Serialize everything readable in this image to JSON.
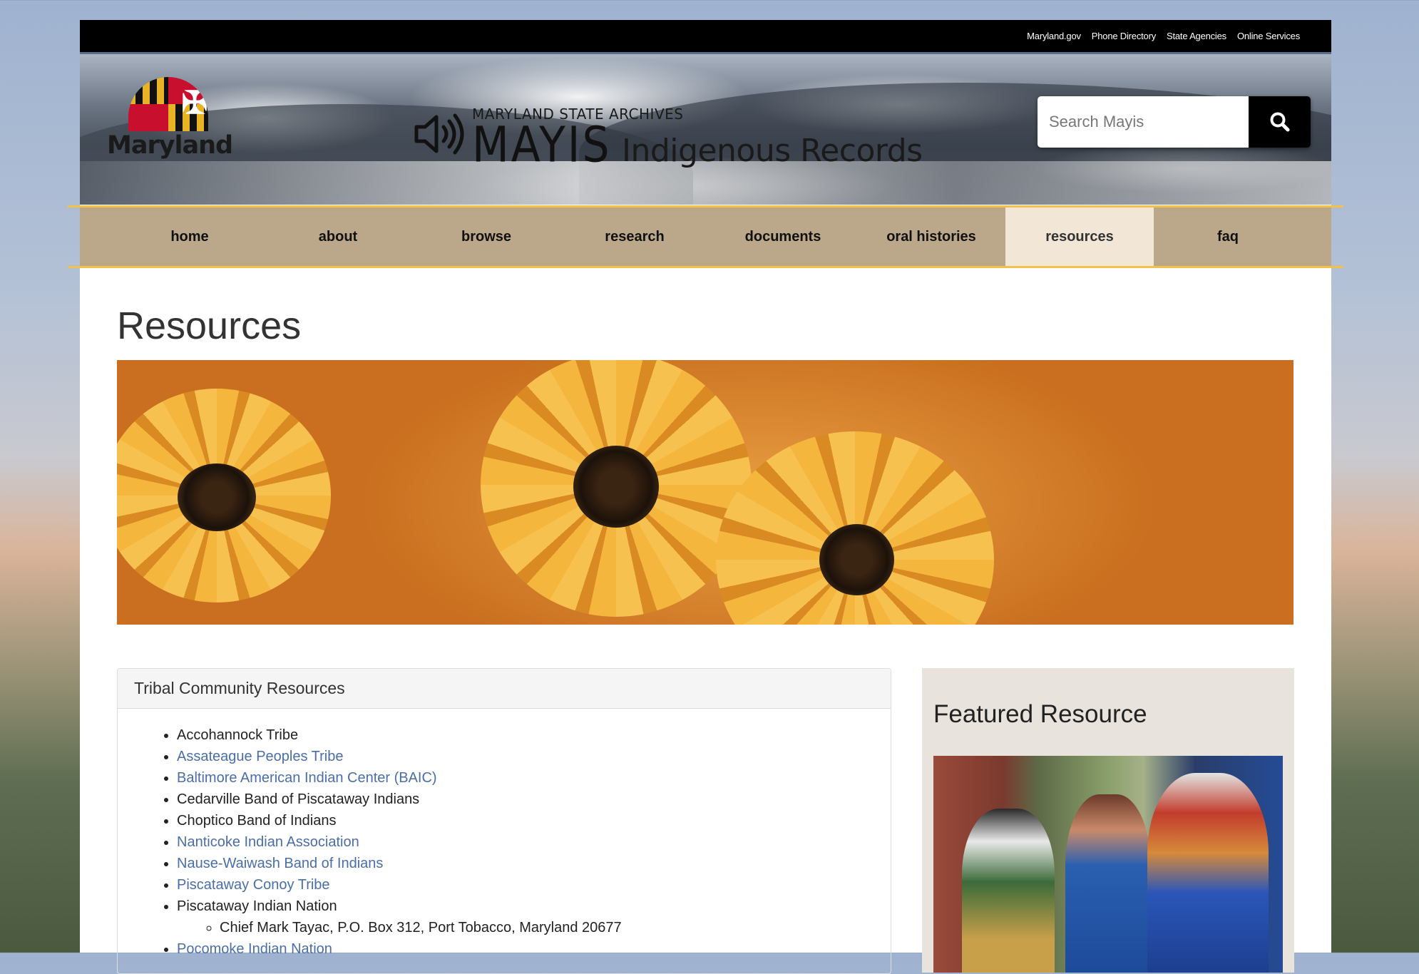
{
  "utility_links": [
    "Maryland.gov",
    "Phone Directory",
    "State Agencies",
    "Online Services"
  ],
  "header": {
    "maryland_logo_text": "Maryland",
    "archive_name": "MARYLAND STATE ARCHIVES",
    "brand": "MAYIS",
    "section_title": "Indigenous Records",
    "search_placeholder": "Search Mayis"
  },
  "nav": {
    "items": [
      "home",
      "about",
      "browse",
      "research",
      "documents",
      "oral histories",
      "resources",
      "faq"
    ],
    "active": "resources"
  },
  "page_title": "Resources",
  "tribal_panel": {
    "title": "Tribal Community Resources",
    "items": [
      {
        "label": "Accohannock Tribe",
        "link": false
      },
      {
        "label": "Assateague Peoples Tribe",
        "link": true
      },
      {
        "label": "Baltimore American Indian Center (BAIC)",
        "link": true
      },
      {
        "label": "Cedarville Band of Piscataway Indians",
        "link": false
      },
      {
        "label": "Choptico Band of Indians",
        "link": false
      },
      {
        "label": "Nanticoke Indian Association",
        "link": true
      },
      {
        "label": "Nause-Waiwash Band of Indians",
        "link": true
      },
      {
        "label": "Piscataway Conoy Tribe",
        "link": true
      },
      {
        "label": "Piscataway Indian Nation",
        "link": false,
        "sub": "Chief Mark Tayac, P.O. Box 312, Port Tobacco, Maryland 20677"
      },
      {
        "label": "Pocomoke Indian Nation",
        "link": true
      }
    ]
  },
  "featured": {
    "title": "Featured Resource"
  },
  "colors": {
    "nav_bg": "#bba88a",
    "nav_active_bg": "#f2e6d6",
    "nav_border": "#f0c24a",
    "link": "#4a6ea8"
  },
  "icons": {
    "search": "search-icon",
    "speaker": "speaker-icon"
  }
}
